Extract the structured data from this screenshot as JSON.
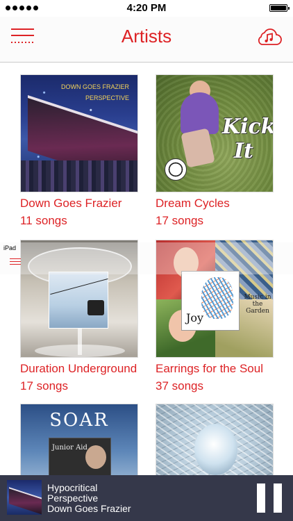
{
  "status_bar": {
    "time": "4:20 PM"
  },
  "nav": {
    "title": "Artists",
    "menu_icon": "hamburger-menu-icon",
    "cloud_icon": "cloud-music-icon",
    "accent_color": "#dd2225"
  },
  "artists": [
    {
      "name": "Down Goes Frazier",
      "count": "11 songs",
      "art_title_line1": "DOWN GOES FRAZIER",
      "art_title_line2": "PERSPECTIVE"
    },
    {
      "name": "Dream Cycles",
      "count": "17 songs",
      "art_text_line1": "Kick",
      "art_text_line2": "It"
    },
    {
      "name": "Duration Underground",
      "count": "17 songs"
    },
    {
      "name": "Earrings for the Soul",
      "count": "37 songs",
      "art_text": "Joy",
      "art_text_2": "Music in the Garden"
    },
    {
      "name": "",
      "count": "",
      "art_title": "SOAR",
      "art_subtitle": "Junior Aid"
    },
    {
      "name": "",
      "count": ""
    }
  ],
  "overlay": {
    "device_label": "iPad"
  },
  "now_playing": {
    "track_line1": "Hypocritical",
    "track_line2": "Perspective",
    "artist": "Down Goes Frazier",
    "control_icon": "pause-icon",
    "background_color": "#35384a"
  }
}
